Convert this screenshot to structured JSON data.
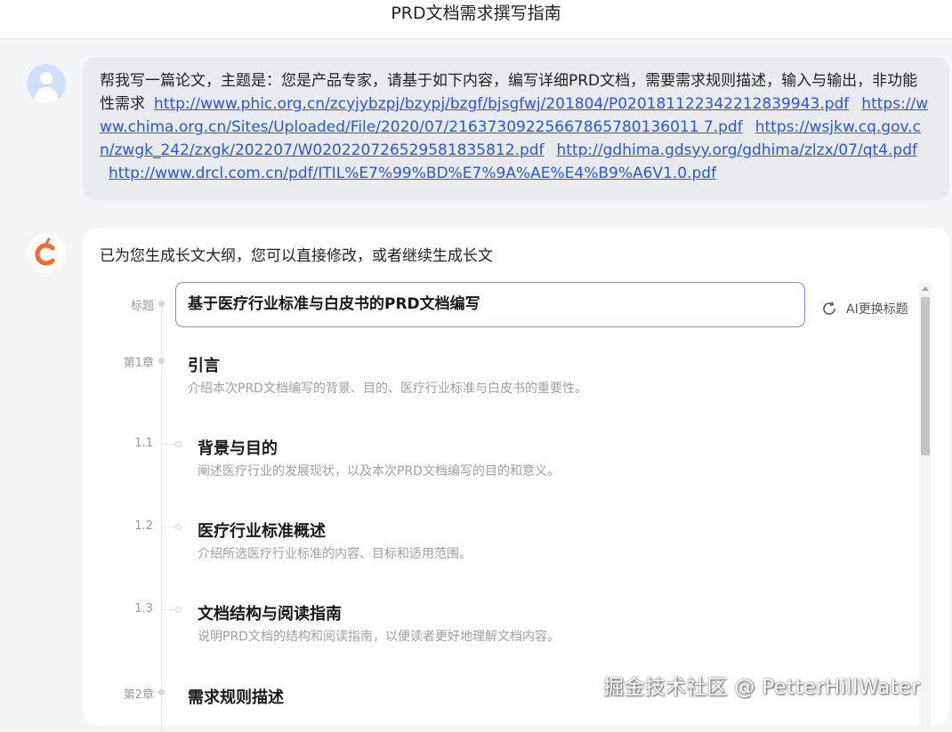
{
  "page": {
    "title": "PRD文档需求撰写指南"
  },
  "user_message": {
    "text": "帮我写一篇论文，主题是：您是产品专家，请基于如下内容，编写详细PRD文档，需要需求规则描述，输入与输出，非功能性需求",
    "links": [
      "http://www.phic.org.cn/zcyjybzpj/bzypj/bzgf/bjsgfwj/201804/P020181122342212839943.pdf",
      "https://www.chima.org.cn/Sites/Uploaded/File/2020/07/21637309225667865780136011 7.pdf",
      "https://wsjkw.cq.gov.cn/zwgk_242/zxgk/202207/W020220726529581835812.pdf",
      "http://gdhima.gdsyy.org/gdhima/zlzx/07/qt4.pdf",
      "http://www.drcl.com.cn/pdf/ITIL%E7%99%BD%E7%9A%AE%E4%B9%A6V1.0.pdf"
    ]
  },
  "bot": {
    "avatar_icon": "orange-c-logo",
    "intro": "已为您生成长文大纲，您可以直接修改，或者继续生成长文",
    "outline": {
      "title_label": "标题",
      "title_value": "基于医疗行业标准与白皮书的PRD文档编写",
      "ai_button_label": "AI更换标题",
      "chapters": [
        {
          "label": "第1章",
          "title": "引言",
          "desc": "介绍本次PRD文档编写的背景、目的、医疗行业标准与白皮书的重要性。",
          "sections": [
            {
              "label": "1.1",
              "title": "背景与目的",
              "desc": "阐述医疗行业的发展现状，以及本次PRD文档编写的目的和意义。"
            },
            {
              "label": "1.2",
              "title": "医疗行业标准概述",
              "desc": "介绍所选医疗行业标准的内容、目标和适用范围。"
            },
            {
              "label": "1.3",
              "title": "文档结构与阅读指南",
              "desc": "说明PRD文档的结构和阅读指南，以便读者更好地理解文档内容。"
            }
          ]
        },
        {
          "label": "第2章",
          "title": "需求规则描述"
        }
      ]
    }
  },
  "watermark": "掘金技术社区 @ PetterHillWater",
  "colors": {
    "accent": "#7f8fe6",
    "link": "#2b57d9",
    "logo": "#f26a2e"
  }
}
